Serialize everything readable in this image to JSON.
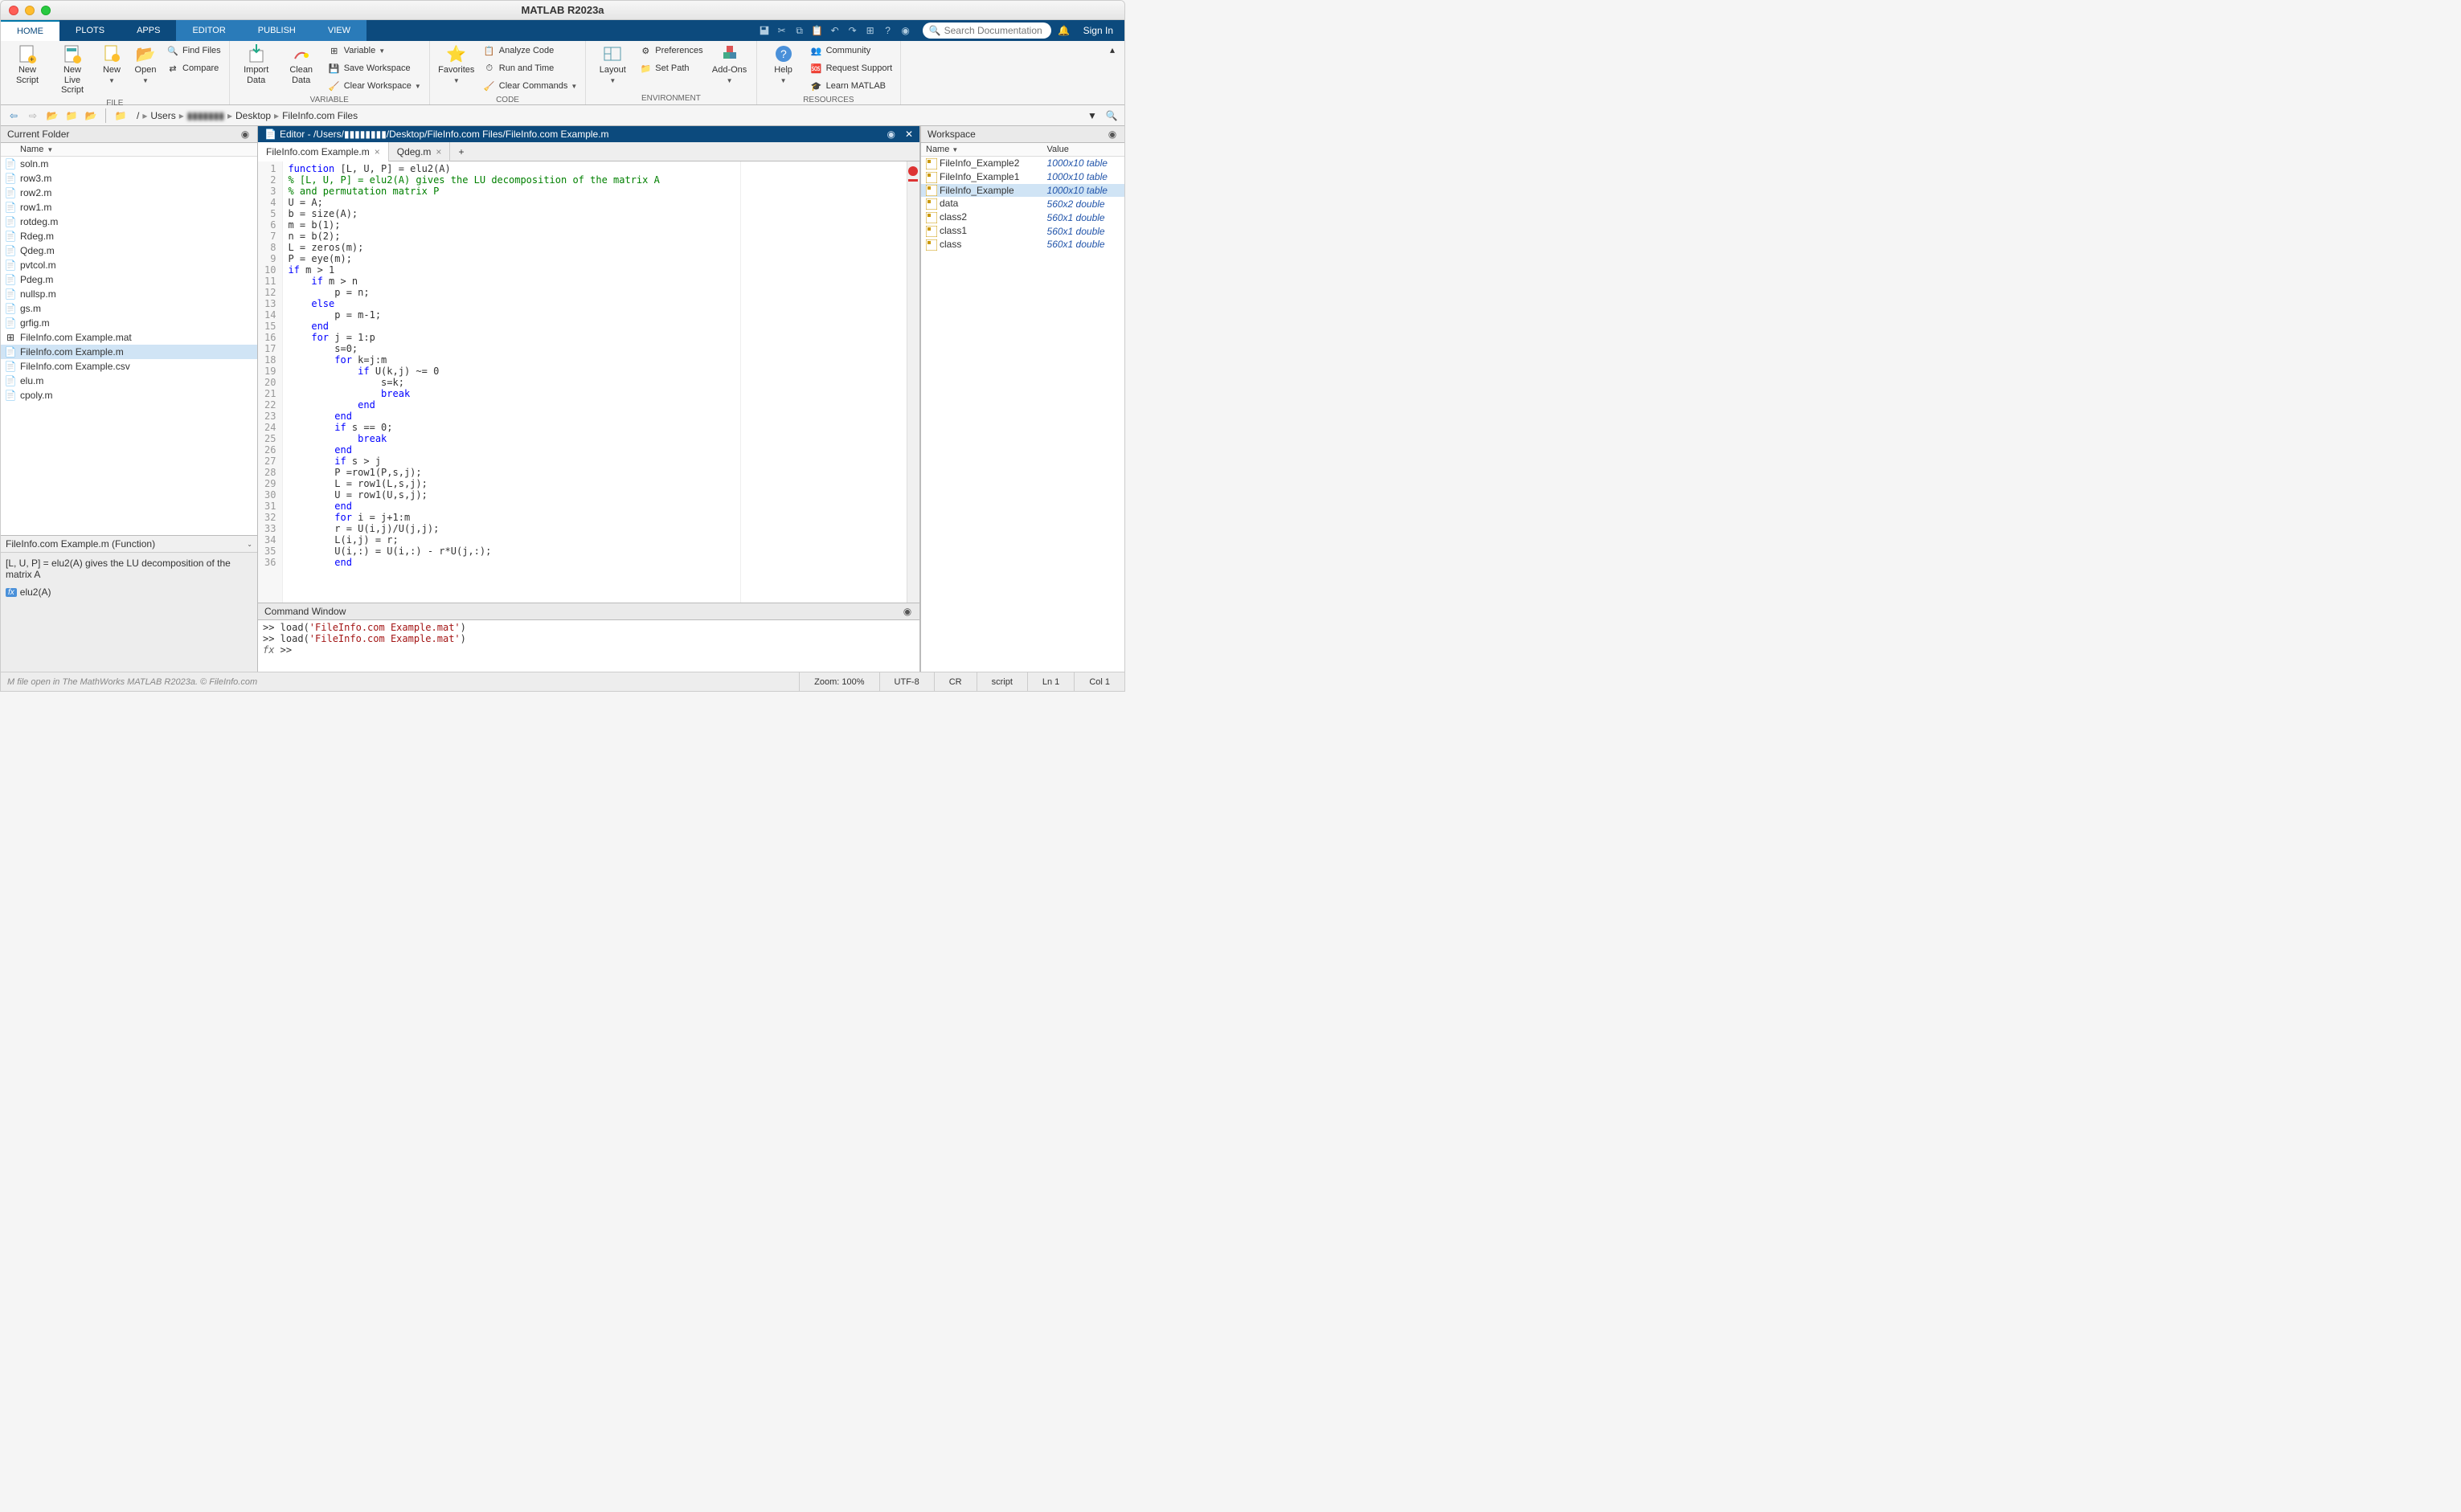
{
  "window": {
    "title": "MATLAB R2023a"
  },
  "mainTabs": [
    "HOME",
    "PLOTS",
    "APPS",
    "EDITOR",
    "PUBLISH",
    "VIEW"
  ],
  "toolstrip": {
    "searchPlaceholder": "Search Documentation",
    "signIn": "Sign In"
  },
  "ribbon": {
    "groups": {
      "file": {
        "label": "FILE",
        "newScript": "New\nScript",
        "newLiveScript": "New\nLive Script",
        "new": "New",
        "open": "Open",
        "findFiles": "Find Files",
        "compare": "Compare"
      },
      "variable": {
        "label": "VARIABLE",
        "importData": "Import\nData",
        "cleanData": "Clean\nData",
        "variable": "Variable",
        "saveWorkspace": "Save Workspace",
        "clearWorkspace": "Clear Workspace"
      },
      "code": {
        "label": "CODE",
        "favorites": "Favorites",
        "analyzeCode": "Analyze Code",
        "runAndTime": "Run and Time",
        "clearCommands": "Clear Commands"
      },
      "environment": {
        "label": "ENVIRONMENT",
        "layout": "Layout",
        "preferences": "Preferences",
        "setPath": "Set Path",
        "addons": "Add-Ons"
      },
      "resources": {
        "label": "RESOURCES",
        "help": "Help",
        "community": "Community",
        "requestSupport": "Request Support",
        "learnMatlab": "Learn MATLAB"
      }
    }
  },
  "pathbar": {
    "segments": [
      "/",
      "Users",
      "▮▮▮▮▮▮▮",
      "Desktop",
      "FileInfo.com Files"
    ]
  },
  "currentFolder": {
    "title": "Current Folder",
    "nameHeader": "Name",
    "files": [
      {
        "name": "soln.m",
        "type": "m"
      },
      {
        "name": "row3.m",
        "type": "m"
      },
      {
        "name": "row2.m",
        "type": "m"
      },
      {
        "name": "row1.m",
        "type": "m"
      },
      {
        "name": "rotdeg.m",
        "type": "m"
      },
      {
        "name": "Rdeg.m",
        "type": "m"
      },
      {
        "name": "Qdeg.m",
        "type": "m"
      },
      {
        "name": "pvtcol.m",
        "type": "m"
      },
      {
        "name": "Pdeg.m",
        "type": "m"
      },
      {
        "name": "nullsp.m",
        "type": "m"
      },
      {
        "name": "gs.m",
        "type": "m"
      },
      {
        "name": "grfig.m",
        "type": "m"
      },
      {
        "name": "FileInfo.com Example.mat",
        "type": "mat"
      },
      {
        "name": "FileInfo.com Example.m",
        "type": "m"
      },
      {
        "name": "FileInfo.com Example.csv",
        "type": "csv"
      },
      {
        "name": "elu.m",
        "type": "m"
      },
      {
        "name": "cpoly.m",
        "type": "m"
      }
    ],
    "selectedIndex": 13
  },
  "detailsPanel": {
    "title": "FileInfo.com Example.m  (Function)",
    "desc": "[L, U, P] = elu2(A) gives the LU decomposition of the matrix A",
    "sig": "elu2(A)"
  },
  "editor": {
    "title": "Editor - /Users/▮▮▮▮▮▮▮▮/Desktop/FileInfo.com Files/FileInfo.com Example.m",
    "tabs": [
      {
        "label": "FileInfo.com Example.m",
        "active": true
      },
      {
        "label": "Qdeg.m",
        "active": false
      }
    ],
    "code": [
      {
        "type": "code",
        "t": "function [L, U, P] = elu2(A)"
      },
      {
        "type": "com",
        "t": "% [L, U, P] = elu2(A) gives the LU decomposition of the matrix A"
      },
      {
        "type": "com",
        "t": "% and permutation matrix P"
      },
      {
        "type": "code",
        "t": "U = A;"
      },
      {
        "type": "code",
        "t": "b = size(A);"
      },
      {
        "type": "code",
        "t": "m = b(1);"
      },
      {
        "type": "code",
        "t": "n = b(2);"
      },
      {
        "type": "code",
        "t": "L = zeros(m);"
      },
      {
        "type": "code",
        "t": "P = eye(m);"
      },
      {
        "type": "code",
        "t": "if m > 1"
      },
      {
        "type": "code",
        "t": "    if m > n"
      },
      {
        "type": "code",
        "t": "        p = n;"
      },
      {
        "type": "code",
        "t": "    else"
      },
      {
        "type": "code",
        "t": "        p = m-1;"
      },
      {
        "type": "code",
        "t": "    end"
      },
      {
        "type": "code",
        "t": "    for j = 1:p"
      },
      {
        "type": "code",
        "t": "        s=0;"
      },
      {
        "type": "code",
        "t": "        for k=j:m"
      },
      {
        "type": "code",
        "t": "            if U(k,j) ~= 0"
      },
      {
        "type": "code",
        "t": "                s=k;"
      },
      {
        "type": "code",
        "t": "                break"
      },
      {
        "type": "code",
        "t": "            end"
      },
      {
        "type": "code",
        "t": "        end"
      },
      {
        "type": "code",
        "t": "        if s == 0;"
      },
      {
        "type": "code",
        "t": "            break"
      },
      {
        "type": "code",
        "t": "        end"
      },
      {
        "type": "code",
        "t": "        if s > j"
      },
      {
        "type": "code",
        "t": "        P =row1(P,s,j);"
      },
      {
        "type": "code",
        "t": "        L = row1(L,s,j);"
      },
      {
        "type": "code",
        "t": "        U = row1(U,s,j);"
      },
      {
        "type": "code",
        "t": "        end"
      },
      {
        "type": "code",
        "t": "        for i = j+1:m"
      },
      {
        "type": "code",
        "t": "        r = U(i,j)/U(j,j);"
      },
      {
        "type": "code",
        "t": "        L(i,j) = r;"
      },
      {
        "type": "code",
        "t": "        U(i,:) = U(i,:) - r*U(j,:);"
      },
      {
        "type": "code",
        "t": "        end"
      }
    ]
  },
  "commandWindow": {
    "title": "Command Window",
    "lines": [
      ">> load('FileInfo.com Example.mat')",
      ">> load('FileInfo.com Example.mat')",
      ">> "
    ]
  },
  "workspace": {
    "title": "Workspace",
    "nameHeader": "Name",
    "valueHeader": "Value",
    "vars": [
      {
        "name": "FileInfo_Example2",
        "value": "1000x10 table"
      },
      {
        "name": "FileInfo_Example1",
        "value": "1000x10 table"
      },
      {
        "name": "FileInfo_Example",
        "value": "1000x10 table"
      },
      {
        "name": "data",
        "value": "560x2 double"
      },
      {
        "name": "class2",
        "value": "560x1 double"
      },
      {
        "name": "class1",
        "value": "560x1 double"
      },
      {
        "name": "class",
        "value": "560x1 double"
      }
    ],
    "selectedIndex": 2
  },
  "statusbar": {
    "hint": "M file open in The MathWorks MATLAB R2023a. © FileInfo.com",
    "zoom": "Zoom: 100%",
    "encoding": "UTF-8",
    "lineEnding": "CR",
    "mode": "script",
    "ln": "Ln  1",
    "col": "Col  1"
  }
}
